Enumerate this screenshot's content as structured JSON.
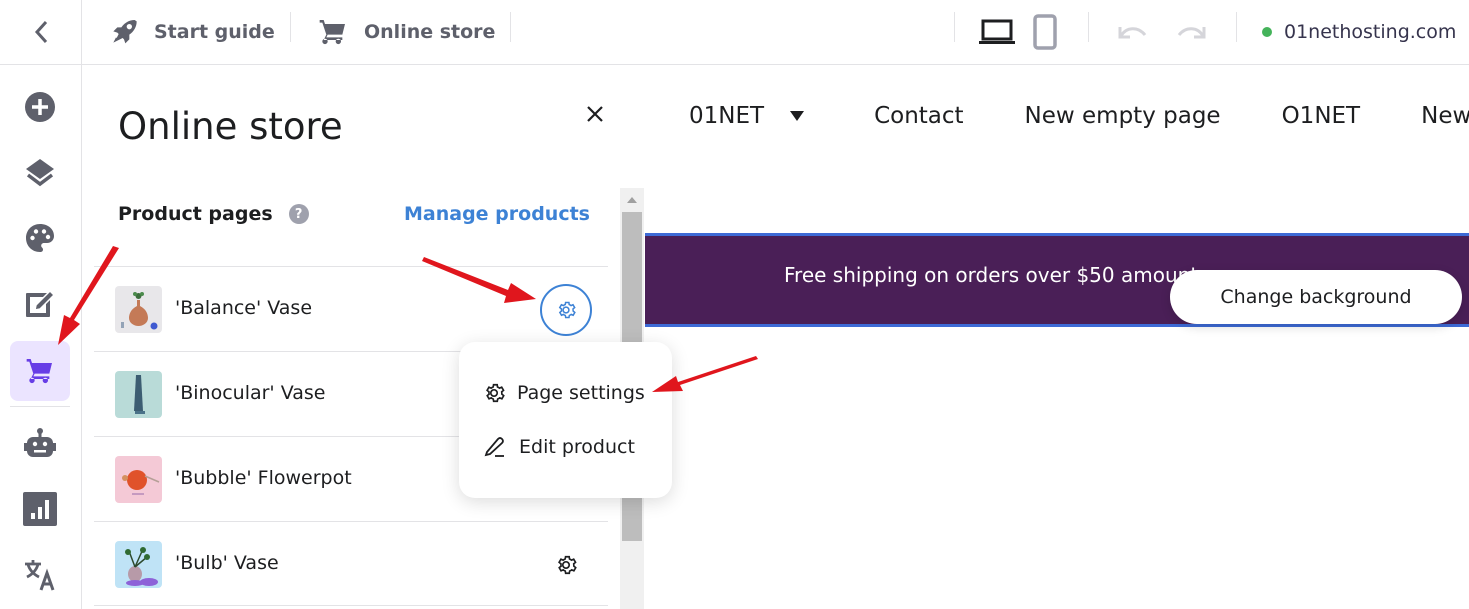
{
  "topbar": {
    "back_icon": "chevron-left-icon",
    "items": [
      {
        "label": "Start guide",
        "icon": "rocket-icon"
      },
      {
        "label": "Online store",
        "icon": "cart-icon"
      }
    ],
    "device_icons": [
      "desktop-icon",
      "mobile-icon"
    ],
    "history_icons": [
      "undo-icon",
      "redo-icon"
    ],
    "domain": "01nethosting.com",
    "domain_status_color": "#44b35a"
  },
  "leftnav": {
    "items": [
      {
        "name": "add",
        "icon": "plus-circle-icon"
      },
      {
        "name": "layers",
        "icon": "layers-icon"
      },
      {
        "name": "design",
        "icon": "palette-icon"
      },
      {
        "name": "edit",
        "icon": "edit-icon"
      },
      {
        "name": "store",
        "icon": "cart-icon",
        "active": true
      },
      {
        "name": "ai",
        "icon": "robot-icon"
      },
      {
        "name": "analytics",
        "icon": "analytics-icon"
      },
      {
        "name": "translate",
        "icon": "translate-icon"
      }
    ],
    "active_color": "#673de6"
  },
  "panel": {
    "title": "Online store",
    "section_label": "Product pages",
    "help_glyph": "?",
    "manage_link": "Manage products",
    "products": [
      {
        "name": "'Balance' Vase"
      },
      {
        "name": "'Binocular' Vase"
      },
      {
        "name": "'Bubble' Flowerpot"
      },
      {
        "name": "'Bulb' Vase"
      }
    ]
  },
  "context_menu": {
    "items": [
      {
        "label": "Page settings",
        "icon": "gear-icon"
      },
      {
        "label": "Edit product",
        "icon": "pencil-icon"
      }
    ]
  },
  "canvas": {
    "nav": [
      "01NET",
      "Contact",
      "New empty page",
      "O1NET",
      "New"
    ],
    "banner_text": "Free shipping on orders over $50 amount",
    "banner_color": "#4a1f57",
    "change_background": "Change background"
  }
}
